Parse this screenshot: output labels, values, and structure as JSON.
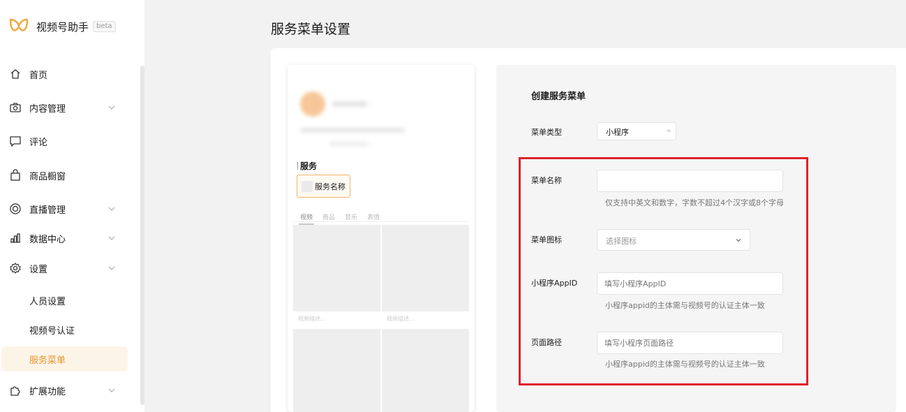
{
  "app": {
    "name": "视频号助手",
    "badge": "beta",
    "accent": "#e8952a"
  },
  "sidebar": {
    "items": [
      {
        "id": "home",
        "label": "首页",
        "icon": "home-icon"
      },
      {
        "id": "content",
        "label": "内容管理",
        "icon": "camera-icon",
        "expandable": true
      },
      {
        "id": "comments",
        "label": "评论",
        "icon": "comment-icon"
      },
      {
        "id": "shop",
        "label": "商品橱窗",
        "icon": "bag-icon"
      },
      {
        "id": "live",
        "label": "直播管理",
        "icon": "live-icon",
        "expandable": true
      },
      {
        "id": "data",
        "label": "数据中心",
        "icon": "chart-icon",
        "expandable": true
      },
      {
        "id": "settings",
        "label": "设置",
        "icon": "gear-icon",
        "expandable": true,
        "expanded": true
      },
      {
        "id": "ext",
        "label": "扩展功能",
        "icon": "puzzle-icon",
        "expandable": true
      }
    ],
    "settings_sub": [
      {
        "label": "人员设置"
      },
      {
        "label": "视频号认证"
      },
      {
        "label": "服务菜单",
        "active": true
      }
    ]
  },
  "page": {
    "title": "服务菜单设置"
  },
  "preview": {
    "service_heading": "服务",
    "service_button": "服务名称",
    "tabs": [
      "视频",
      "商品",
      "音乐",
      "表情"
    ],
    "tile_caption": "视频描述..."
  },
  "form": {
    "title": "创建服务菜单",
    "type_label": "菜单类型",
    "type_value": "小程序",
    "name_label": "菜单名称",
    "name_hint": "仅支持中英文和数字，字数不超过4个汉字或8个字母",
    "icon_label": "菜单图标",
    "icon_placeholder": "选择图标",
    "appid_label": "小程序AppID",
    "appid_placeholder": "填写小程序AppID",
    "appid_hint": "小程序appid的主体需与视频号的认证主体一致",
    "path_label": "页面路径",
    "path_placeholder": "填写小程序页面路径",
    "path_hint": "小程序appid的主体需与视频号的认证主体一致"
  }
}
